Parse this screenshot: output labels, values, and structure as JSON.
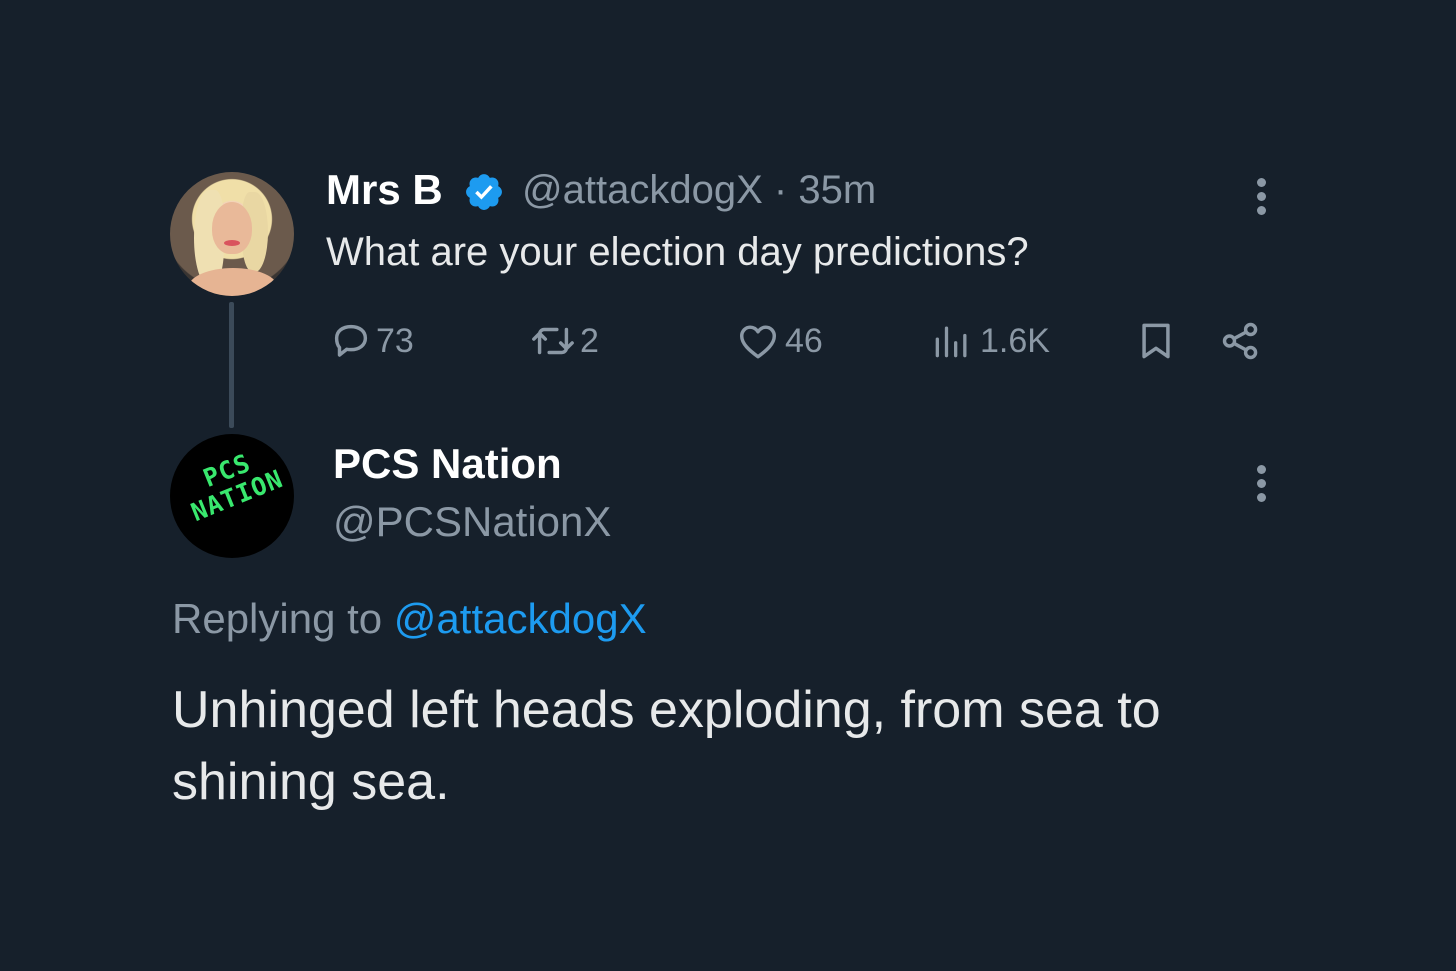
{
  "original_tweet": {
    "display_name": "Mrs B",
    "handle": "@attackdogX",
    "separator": "·",
    "time": "35m",
    "text": "What are your election day predictions?",
    "stats": {
      "replies": "73",
      "reposts": "2",
      "likes": "46",
      "views": "1.6K"
    }
  },
  "reply_tweet": {
    "display_name": "PCS Nation",
    "handle": "@PCSNationX",
    "avatar_text_line1": "PCS",
    "avatar_text_line2": "NATION",
    "replying_to_prefix": "Replying to",
    "replying_to_handle": "@attackdogX",
    "text": "Unhinged left heads exploding, from sea to shining sea."
  },
  "colors": {
    "background": "#16202b",
    "accent": "#1d9bf0",
    "muted": "#8b98a5",
    "text": "#e7e9ea"
  },
  "icons": {
    "verified": "verified-badge-icon",
    "reply": "reply-bubble-icon",
    "repost": "repost-icon",
    "like": "heart-icon",
    "views": "views-bar-icon",
    "bookmark": "bookmark-icon",
    "share": "share-icon",
    "more": "more-vertical-icon"
  }
}
